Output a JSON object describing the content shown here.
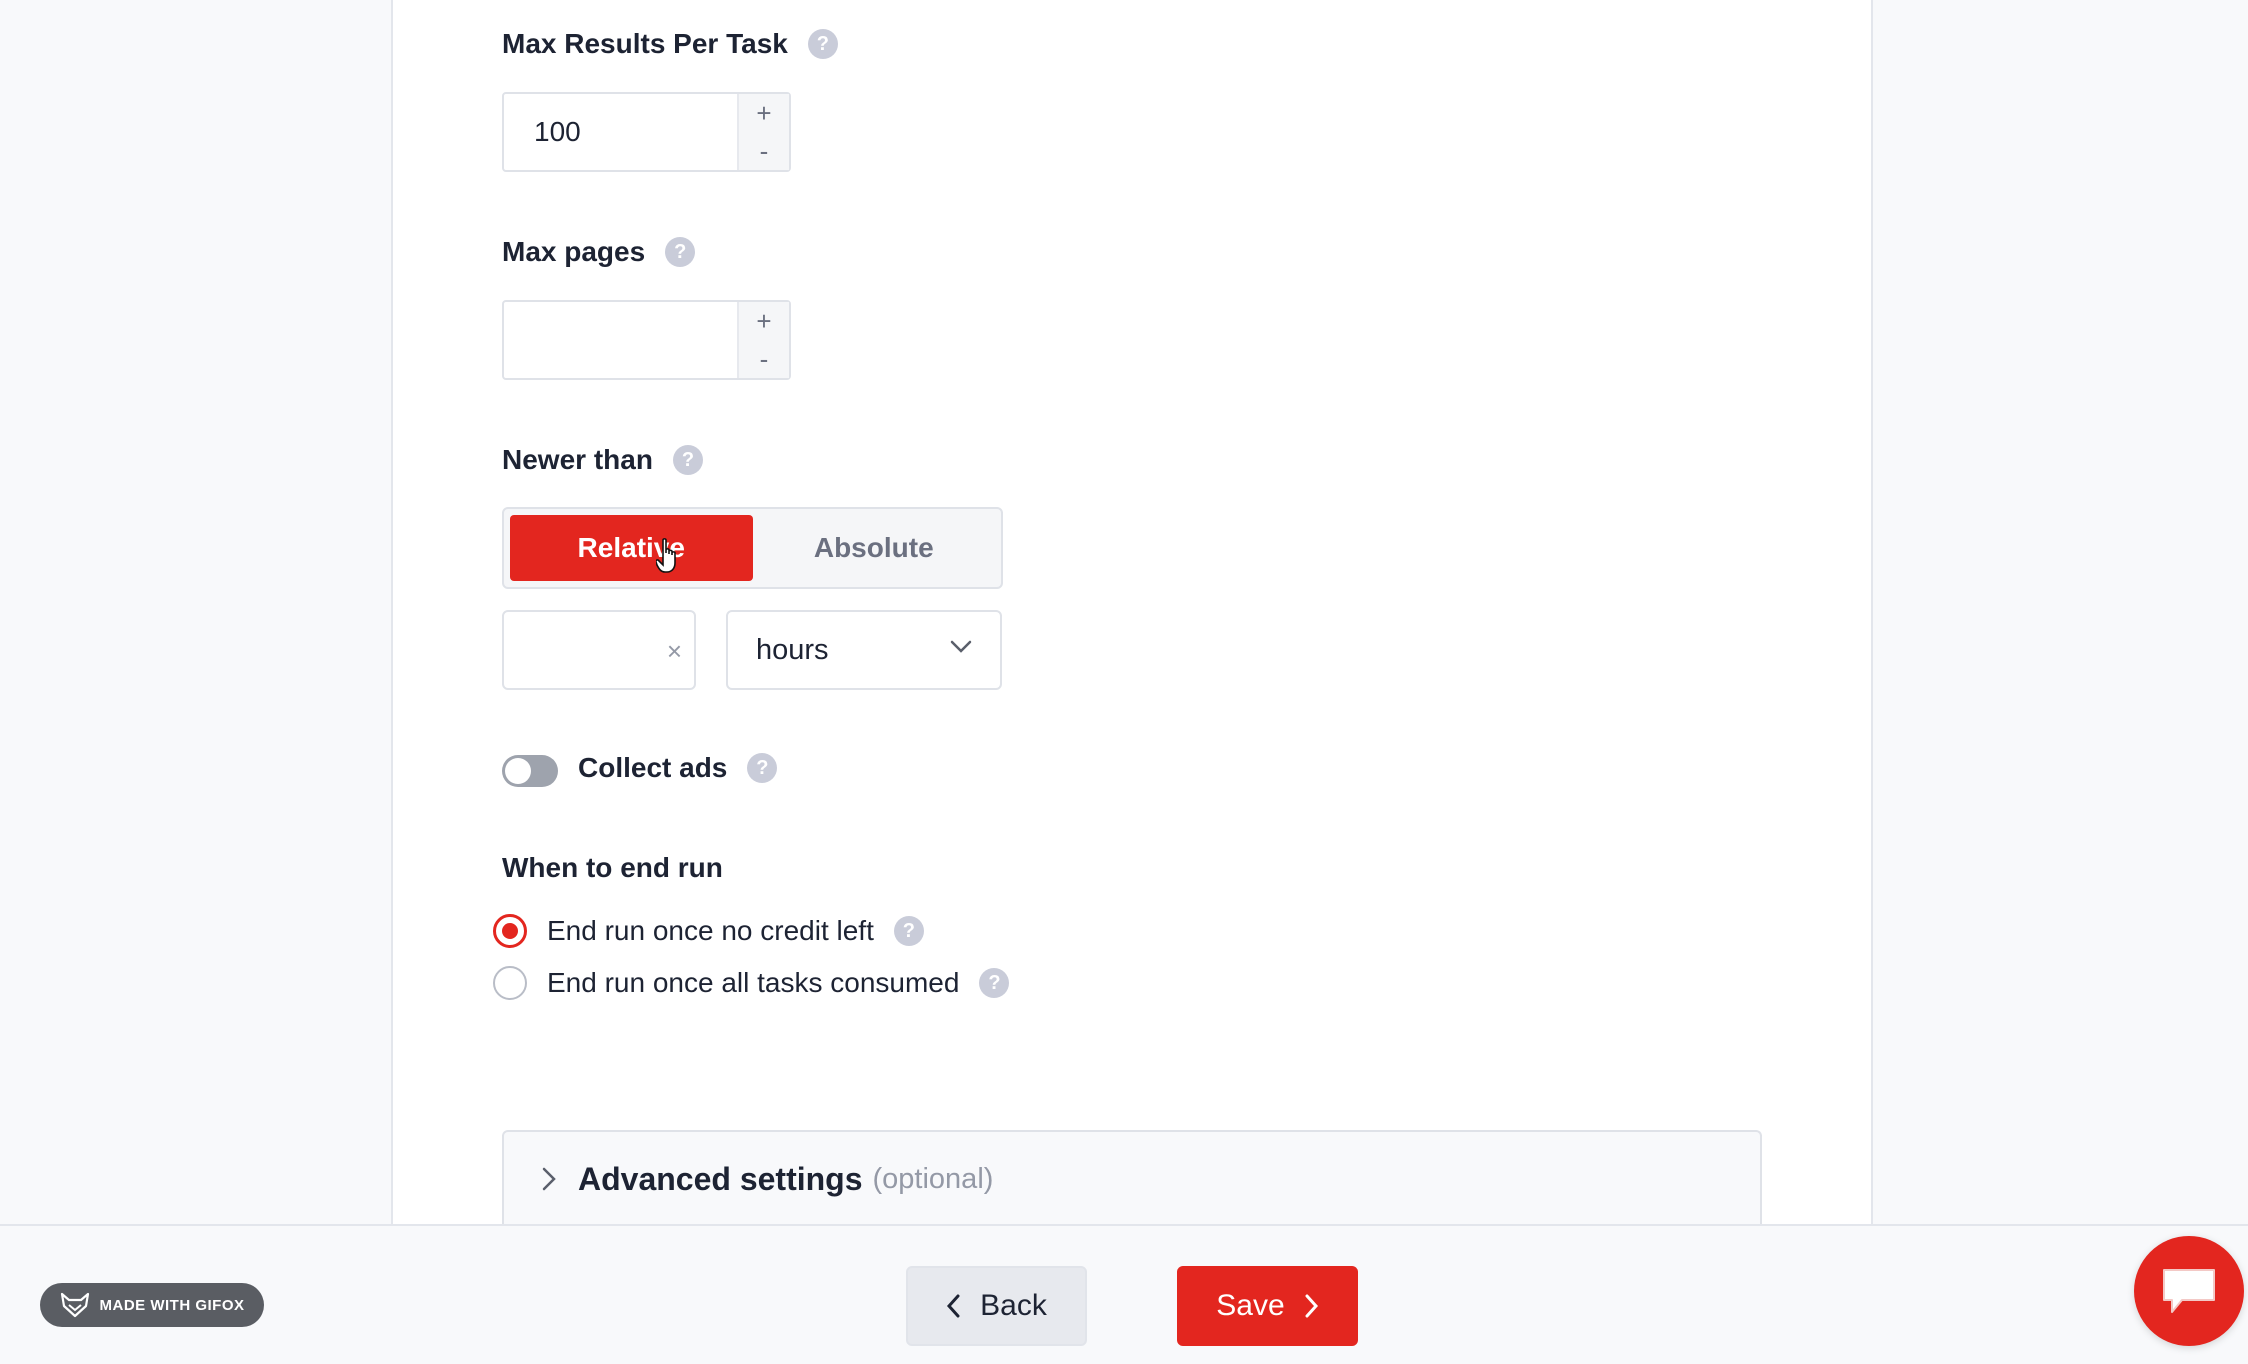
{
  "max_results": {
    "label": "Max Results Per Task",
    "value": "100",
    "plus": "+",
    "minus": "-"
  },
  "max_pages": {
    "label": "Max pages",
    "value": "",
    "plus": "+",
    "minus": "-"
  },
  "newer_than": {
    "label": "Newer than",
    "modes": [
      "Relative",
      "Absolute"
    ],
    "active_mode": "Relative",
    "amount": "",
    "clear_symbol": "×",
    "unit": "hours"
  },
  "collect_ads": {
    "label": "Collect ads",
    "enabled": false
  },
  "end_run": {
    "title": "When to end run",
    "options": [
      {
        "label": "End run once no credit left",
        "checked": true
      },
      {
        "label": "End run once all tasks consumed",
        "checked": false
      }
    ]
  },
  "advanced": {
    "title": "Advanced settings",
    "optional": "(optional)"
  },
  "footer": {
    "back_label": "Back",
    "save_label": "Save",
    "gifox_label": "MADE WITH GIFOX"
  },
  "help_symbol": "?",
  "colors": {
    "accent": "#e3261f",
    "help": "#c9ccd9",
    "toggle_off": "#9ea3ad"
  }
}
